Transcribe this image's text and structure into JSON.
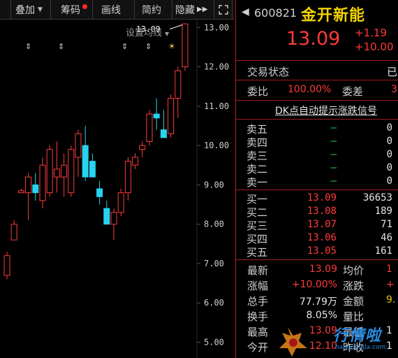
{
  "toolbar": {
    "items": [
      {
        "label": "叠加",
        "caret": "▼"
      },
      {
        "label": "筹码"
      },
      {
        "label": "画线"
      },
      {
        "label": "简约"
      },
      {
        "label": "隐藏",
        "arrows": "▶▶"
      }
    ],
    "fullscreen_icon": "fullscreen-icon",
    "accent": "#ff2a2a"
  },
  "chart": {
    "ma_setting_label": "设置均线",
    "callout_price": "13.09",
    "y_ticks": [
      "13.00",
      "12.00",
      "11.00",
      "10.00",
      "9.00",
      "8.00",
      "7.00",
      "6.00",
      "5.00"
    ],
    "colors": {
      "up": "#ff3b3b",
      "down": "#27d3ef",
      "ma": "#ffffff"
    }
  },
  "chart_data": {
    "type": "candlestick",
    "ylim": [
      4.6,
      13.2
    ],
    "ohlc": [
      [
        6.7,
        7.3,
        6.6,
        7.2
      ],
      [
        7.6,
        8.1,
        7.6,
        8.0
      ],
      [
        8.8,
        8.9,
        8.8,
        8.85
      ],
      [
        8.8,
        9.3,
        8.1,
        9.2
      ],
      [
        9.0,
        9.3,
        8.6,
        8.8
      ],
      [
        8.6,
        9.7,
        8.4,
        9.5
      ],
      [
        8.8,
        10.0,
        8.7,
        9.9
      ],
      [
        9.2,
        10.1,
        8.8,
        9.4
      ],
      [
        9.2,
        9.8,
        8.7,
        9.5
      ],
      [
        8.8,
        10.0,
        8.7,
        9.9
      ],
      [
        9.7,
        10.4,
        9.2,
        10.3
      ],
      [
        10.0,
        10.5,
        9.1,
        9.2
      ],
      [
        9.6,
        9.8,
        9.3,
        9.2
      ],
      [
        8.9,
        9.1,
        8.5,
        8.7
      ],
      [
        8.4,
        8.6,
        8.2,
        8.0
      ],
      [
        8.0,
        8.4,
        7.6,
        8.3
      ],
      [
        8.3,
        8.9,
        8.2,
        8.8
      ],
      [
        8.8,
        9.7,
        8.6,
        9.6
      ],
      [
        9.5,
        9.8,
        9.4,
        9.7
      ],
      [
        9.9,
        10.1,
        9.7,
        10.0
      ],
      [
        10.1,
        10.9,
        10.0,
        10.8
      ],
      [
        10.8,
        11.2,
        10.4,
        10.7
      ],
      [
        10.4,
        10.9,
        10.3,
        10.2
      ],
      [
        10.3,
        11.3,
        10.2,
        11.2
      ],
      [
        11.2,
        12.0,
        10.7,
        11.9
      ],
      [
        12.0,
        13.1,
        11.9,
        13.09
      ]
    ]
  },
  "stock": {
    "back_icon": "back-arrow-icon",
    "code": "600821",
    "name": "金开新能",
    "price": "13.09",
    "change": "+1.19",
    "change_pct": "+10.00",
    "status_label": "交易状态",
    "status_value": "已",
    "weibi_label": "委比",
    "weibi_value": "100.00%",
    "weicha_label": "委差",
    "weicha_value": "3",
    "dk_link": "DK点自动提示涨跌信号"
  },
  "sell": [
    {
      "label": "卖五",
      "price": "—",
      "vol": "0"
    },
    {
      "label": "卖四",
      "price": "—",
      "vol": "0"
    },
    {
      "label": "卖三",
      "price": "—",
      "vol": "0"
    },
    {
      "label": "卖二",
      "price": "—",
      "vol": "0"
    },
    {
      "label": "卖一",
      "price": "—",
      "vol": "0"
    }
  ],
  "buy": [
    {
      "label": "买一",
      "price": "13.09",
      "vol": "36653"
    },
    {
      "label": "买二",
      "price": "13.08",
      "vol": "189"
    },
    {
      "label": "买三",
      "price": "13.07",
      "vol": "71"
    },
    {
      "label": "买四",
      "price": "13.06",
      "vol": "46"
    },
    {
      "label": "买五",
      "price": "13.05",
      "vol": "161"
    }
  ],
  "stats": [
    {
      "l1": "最新",
      "v1": "13.09",
      "c1": "red",
      "l2": "均价",
      "v2": "1",
      "c2": "red"
    },
    {
      "l1": "涨幅",
      "v1": "+10.00%",
      "c1": "red",
      "l2": "涨跌",
      "v2": "+",
      "c2": "red"
    },
    {
      "l1": "总手",
      "v1": "77.79万",
      "c1": "wht",
      "l2": "金额",
      "v2": "9.",
      "c2": "yel"
    },
    {
      "l1": "换手",
      "v1": "8.05%",
      "c1": "wht",
      "l2": "量比",
      "v2": "",
      "c2": "wht"
    },
    {
      "l1": "最高",
      "v1": "13.09",
      "c1": "red",
      "l2": "最低",
      "v2": "1",
      "c2": "wht"
    },
    {
      "l1": "今开",
      "v1": "12.10",
      "c1": "red",
      "l2": "昨收",
      "v2": "1",
      "c2": "wht"
    }
  ],
  "watermark": {
    "text": "行情啦",
    "url": "hangqingla.com"
  }
}
